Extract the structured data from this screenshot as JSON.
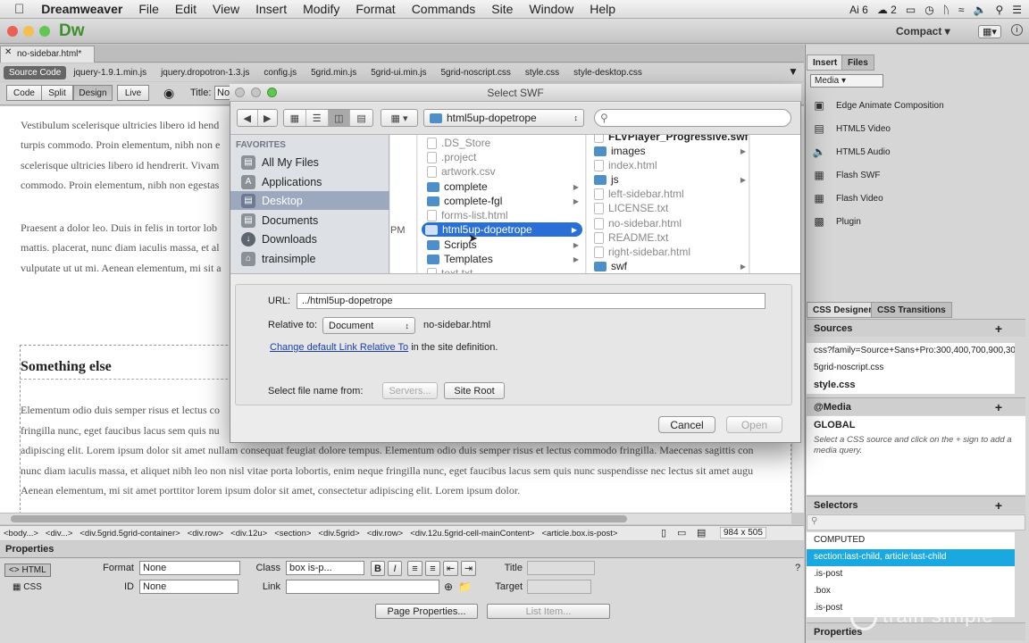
{
  "menubar": {
    "app": "Dreamweaver",
    "items": [
      "File",
      "Edit",
      "View",
      "Insert",
      "Modify",
      "Format",
      "Commands",
      "Site",
      "Window",
      "Help"
    ],
    "status": {
      "adobe_count": "6",
      "cc_count": "2"
    }
  },
  "appbar": {
    "logo": "Dw",
    "workspace": "Compact"
  },
  "document": {
    "tab": "no-sidebar.html*",
    "related_files": [
      "Source Code",
      "jquery-1.9.1.min.js",
      "jquery.dropotron-1.3.js",
      "config.js",
      "5grid.min.js",
      "5grid-ui.min.js",
      "5grid-noscript.css",
      "style.css",
      "style-desktop.css"
    ],
    "view_buttons": [
      "Code",
      "Split",
      "Design",
      "Live"
    ],
    "title_label": "Title:",
    "title_value": "No",
    "para1": [
      "Vestibulum scelerisque ultricies libero id hend",
      "turpis commodo. Proin elementum, nibh non e",
      "scelerisque ultricies libero id hendrerit. Vivam",
      "commodo. Proin elementum, nibh non egestas"
    ],
    "para2": [
      "Praesent a dolor leo. Duis in felis in tortor lob",
      "mattis. placerat, nunc diam iaculis massa, et al",
      "vulputate ut ut mi. Aenean elementum, mi sit a"
    ],
    "heading": "Something else",
    "para3": [
      "Elementum odio duis semper risus et lectus co",
      "fringilla nunc, eget faucibus lacus sem quis nu",
      "adipiscing elit. Lorem ipsum dolor sit amet nullam consequat feugiat dolore tempus. Elementum odio duis semper risus et lectus commodo fringilla. Maecenas sagittis con",
      "nunc diam iaculis massa, et aliquet nibh leo non nisl vitae porta lobortis, enim neque fringilla nunc, eget faucibus lacus sem quis nunc suspendisse nec lectus sit amet augu",
      "Aenean elementum, mi sit amet porttitor lorem ipsum dolor sit amet, consectetur adipiscing elit. Lorem ipsum dolor."
    ],
    "pm": "PM",
    "tags": [
      "<body...>",
      "<div...>",
      "<div.5grid.5grid-container>",
      "<div.row>",
      "<div.12u>",
      "<section>",
      "<div.5grid>",
      "<div.row>",
      "<div.12u.5grid-cell-mainContent>",
      "<article.box.is-post>"
    ],
    "window_size": "984 x 505"
  },
  "properties": {
    "title": "Properties",
    "html_tab": "HTML",
    "css_tab": "CSS",
    "format_label": "Format",
    "format_value": "None",
    "id_label": "ID",
    "id_value": "None",
    "class_label": "Class",
    "class_value": "box is-p...",
    "link_label": "Link",
    "link_value": "",
    "title_label": "Title",
    "target_label": "Target",
    "page_properties": "Page Properties...",
    "list_item": "List Item..."
  },
  "panels": {
    "insert_tab": "Insert",
    "files_tab": "Files",
    "category": "Media",
    "insert_items": [
      "Edge Animate Composition",
      "HTML5 Video",
      "HTML5 Audio",
      "Flash SWF",
      "Flash Video",
      "Plugin"
    ],
    "css_designer_tab": "CSS Designer",
    "css_transitions_tab": "CSS Transitions",
    "sources_label": "Sources",
    "sources": [
      "css?family=Source+Sans+Pro:300,400,700,900,30...",
      "5grid-noscript.css",
      "style.css"
    ],
    "media_label": "@Media",
    "global_label": "GLOBAL",
    "media_hint": "Select a CSS source and click on the + sign to add a media query.",
    "selectors_label": "Selectors",
    "selectors": [
      "COMPUTED",
      "section:last-child, article:last-child",
      ".is-post",
      ".box",
      ".is-post"
    ],
    "properties_label": "Properties"
  },
  "dialog": {
    "title": "Select SWF",
    "location": "html5up-dopetrope",
    "favorites_label": "FAVORITES",
    "favorites": [
      "All My Files",
      "Applications",
      "Desktop",
      "Documents",
      "Downloads",
      "trainsimple"
    ],
    "col1": [
      ".DS_Store",
      ".project",
      "artwork.csv",
      "complete",
      "complete-fgl",
      "forms-list.html",
      "html5up-dopetrope",
      "Scripts",
      "Templates",
      "text.txt"
    ],
    "col2": [
      "FLVPlayer_Progressive.swf",
      "images",
      "index.html",
      "js",
      "left-sidebar.html",
      "LICENSE.txt",
      "no-sidebar.html",
      "README.txt",
      "right-sidebar.html",
      "swf"
    ],
    "url_label": "URL:",
    "url_value": "../html5up-dopetrope",
    "relative_label": "Relative to:",
    "relative_value": "Document",
    "relative_file": "no-sidebar.html",
    "change_link": "Change default Link Relative To",
    "change_suffix": "in the site definition.",
    "select_from_label": "Select file name from:",
    "servers_btn": "Servers...",
    "site_root_btn": "Site Root",
    "cancel_btn": "Cancel",
    "open_btn": "Open"
  },
  "watermark": "train simple",
  "colors": {
    "selection": "#2a6fd6",
    "selector_highlight": "#19a8e0",
    "sidebar_selected": "#9ba8be",
    "link": "#1a3fa8"
  }
}
